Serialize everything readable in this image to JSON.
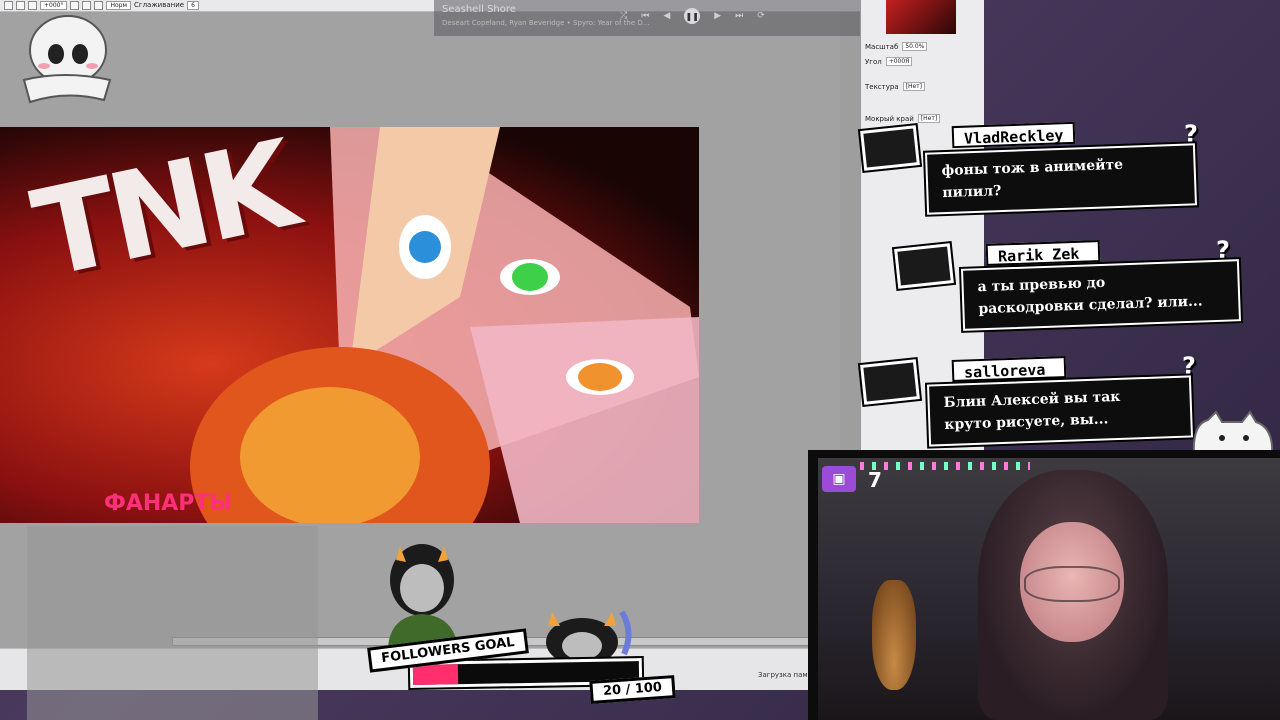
{
  "toolbar": {
    "angle_value": "+000°",
    "mode_value": "Норм",
    "smoothing_label": "Сглаживание",
    "smoothing_value": "6"
  },
  "media": {
    "title": "Seashell Shore",
    "subtitle": "Deseart Copeland, Ryan Beveridge • Spyro: Year of the D..."
  },
  "right_panel": {
    "zoom_label": "Масштаб",
    "zoom_value": "50.0%",
    "angle_label": "Угол",
    "angle_value": "+000Я",
    "texture_label": "Текстура",
    "texture_value": "[Нет]",
    "wet_label": "Мокрый край",
    "wet_value": "[Нет]"
  },
  "artwork": {
    "title": "TNK",
    "subtitle": "ФАНАРТЫ"
  },
  "statusbar": {
    "text": "Загрузка памяти"
  },
  "chat": [
    {
      "username": "VladReckley",
      "message": "фоны тож в анимейте\nпилил?"
    },
    {
      "username": "Rarik_Zek_",
      "message": "а ты превью до\nраскодровки сделал? или..."
    },
    {
      "username": "salloreva_",
      "message": "Блин Алексей вы так\nкруто рисуете, вы..."
    }
  ],
  "chat_marker": "?",
  "goal": {
    "label": "FOLLOWERS GOAL",
    "count": "20 / 100",
    "progress": 0.2
  },
  "webcam": {
    "viewer_count": "7"
  },
  "colors": {
    "accent_pink": "#ff2f6e",
    "chat_bg": "#0d0d0d",
    "overlay_purple": "#4a3a5e"
  }
}
